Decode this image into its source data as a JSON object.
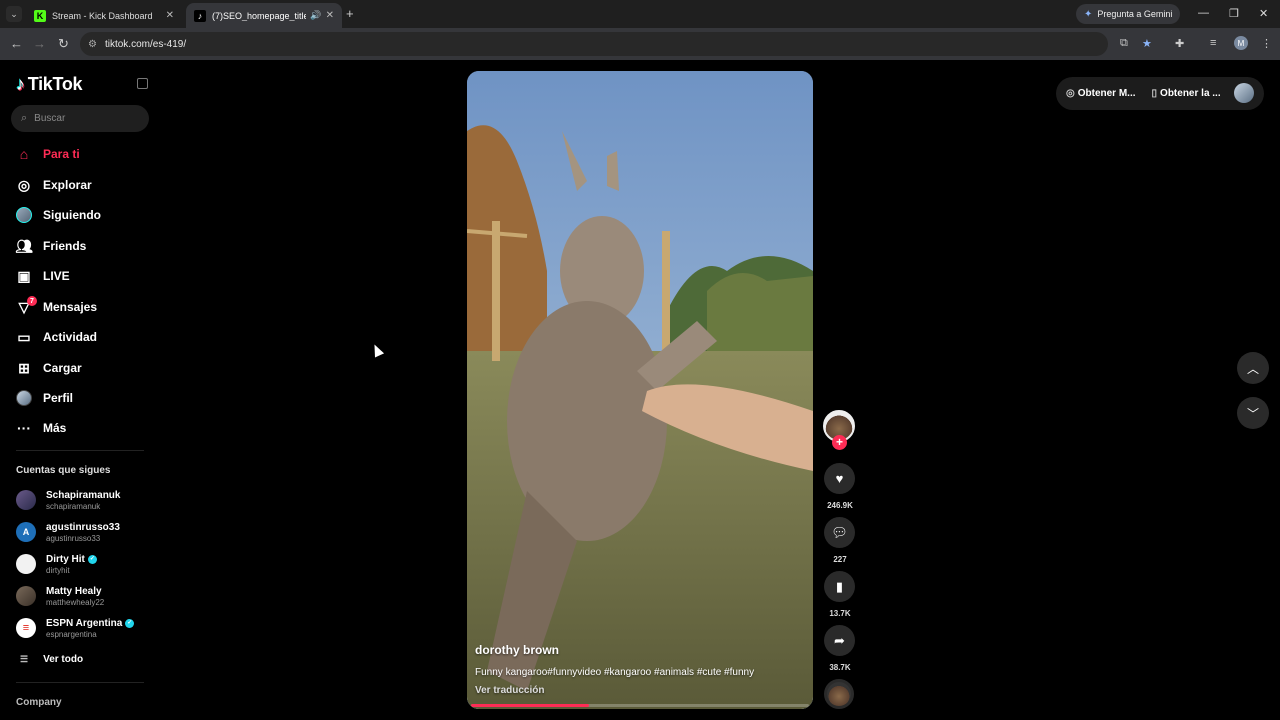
{
  "browser": {
    "tabs": [
      {
        "title": "Stream - Kick Dashboard",
        "favicon": "kick-icon"
      },
      {
        "title": "(7)SEO_homepage_title",
        "favicon": "tiktok-icon"
      }
    ],
    "gemini_label": "Pregunta a Gemini",
    "url": "tiktok.com/es-419/",
    "profile_initial": "M"
  },
  "sidebar": {
    "logo": "TikTok",
    "search_placeholder": "Buscar",
    "nav": [
      {
        "label": "Para ti",
        "icon": "home-icon",
        "active": true
      },
      {
        "label": "Explorar",
        "icon": "compass-icon"
      },
      {
        "label": "Siguiendo",
        "icon": "avatar-icon"
      },
      {
        "label": "Friends",
        "icon": "friends-icon"
      },
      {
        "label": "LIVE",
        "icon": "live-icon"
      },
      {
        "label": "Mensajes",
        "icon": "messages-icon",
        "badge": "7"
      },
      {
        "label": "Actividad",
        "icon": "activity-icon"
      },
      {
        "label": "Cargar",
        "icon": "upload-icon"
      },
      {
        "label": "Perfil",
        "icon": "profile-icon"
      },
      {
        "label": "Más",
        "icon": "more-icon"
      }
    ],
    "following_title": "Cuentas que sigues",
    "accounts": [
      {
        "name": "Schapiramanuk",
        "handle": "schapiramanuk",
        "verified": false
      },
      {
        "name": "agustinrusso33",
        "handle": "agustinrusso33",
        "verified": false,
        "initial": "A"
      },
      {
        "name": "Dirty Hit",
        "handle": "dirtyhit",
        "verified": true
      },
      {
        "name": "Matty Healy",
        "handle": "matthewhealy22",
        "verified": false
      },
      {
        "name": "ESPN Argentina",
        "handle": "espnargentina",
        "verified": true
      }
    ],
    "see_all": "Ver todo",
    "company": "Company"
  },
  "video": {
    "author": "dorothy brown",
    "caption": "Funny kangaroo#funnyvideo #kangaroo #animals #cute #funny",
    "translate": "Ver traducción",
    "progress": 0.35
  },
  "actions": {
    "likes": "246.9K",
    "comments": "227",
    "saves": "13.7K",
    "shares": "38.7K"
  },
  "top_right": {
    "item1": "Obtener M...",
    "item2": "Obtener la ..."
  },
  "colors": {
    "accent": "#fe2c55",
    "cyan": "#25f4ee"
  }
}
